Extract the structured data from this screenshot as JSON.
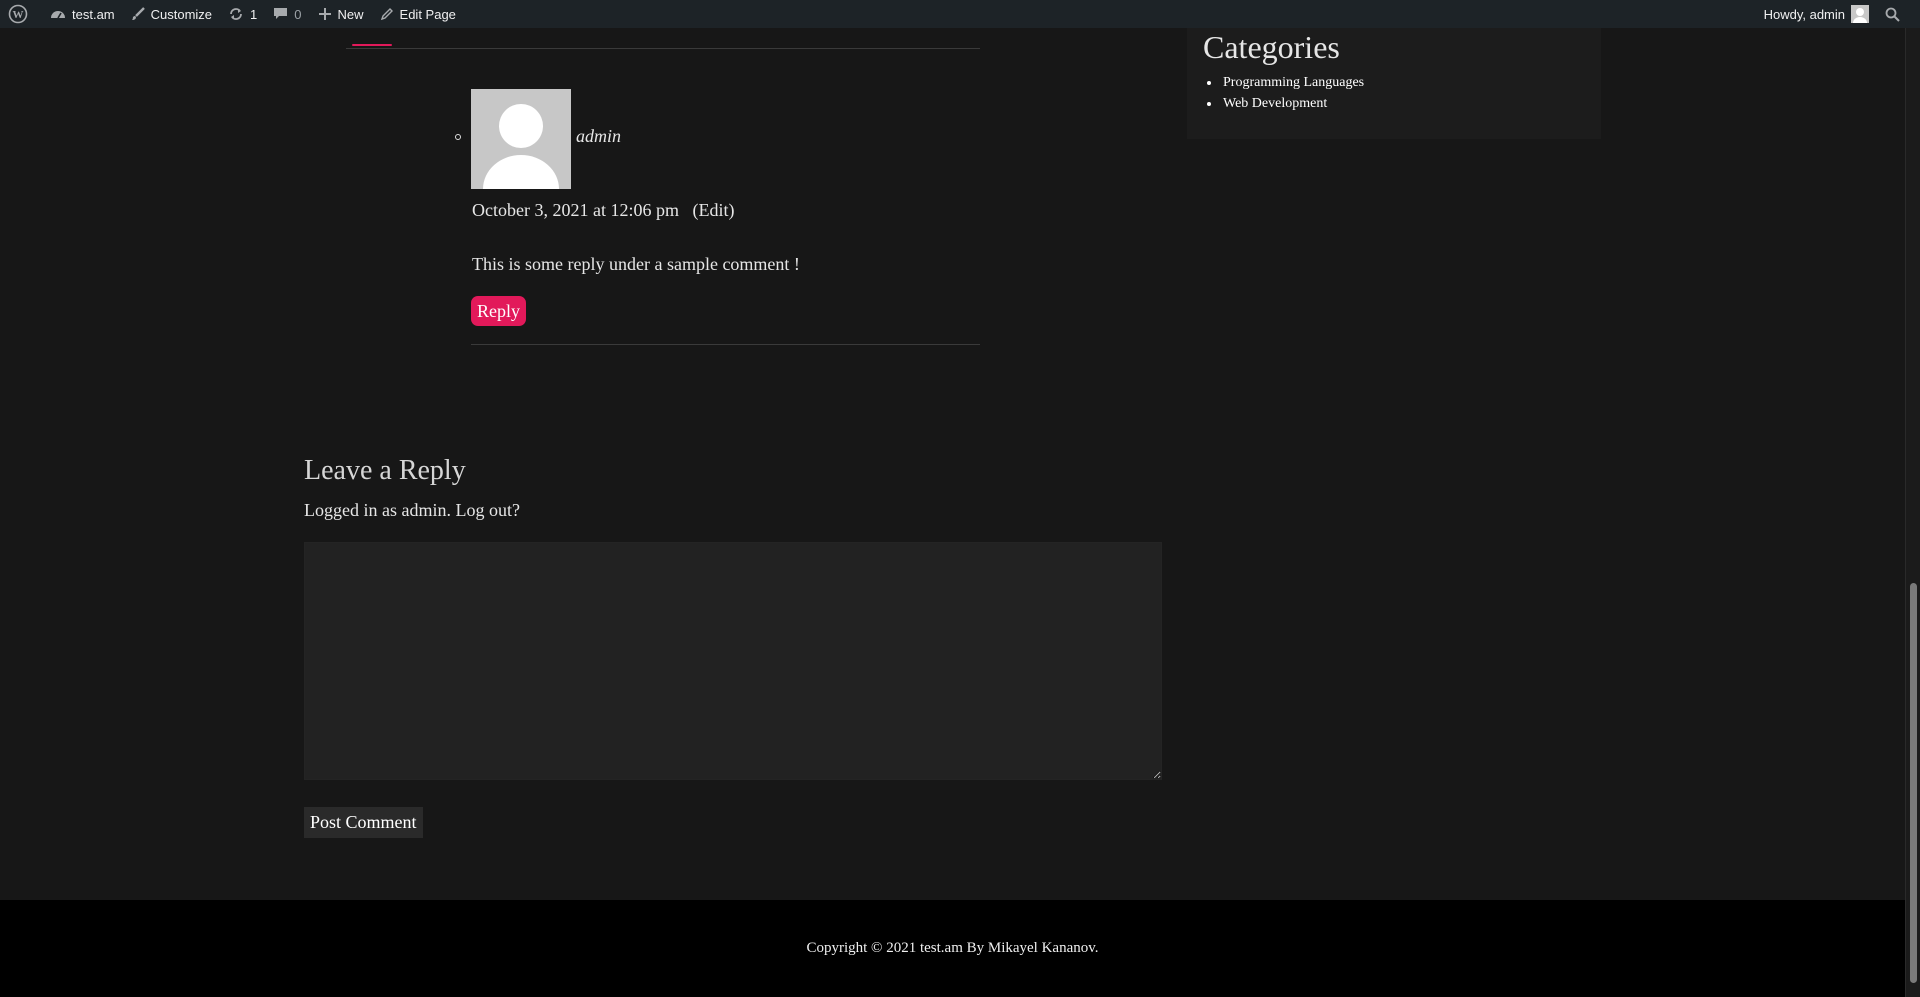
{
  "admin_bar": {
    "site_name": "test.am",
    "customize": "Customize",
    "updates_count": "1",
    "comments_count": "0",
    "new_label": "New",
    "edit_page": "Edit Page",
    "howdy": "Howdy, admin"
  },
  "comment": {
    "author": "admin",
    "date": "October 3, 2021 at 12:06 pm",
    "edit_label": "(Edit)",
    "text": "This is some reply under a sample comment !",
    "reply_label": "Reply"
  },
  "leave_reply": {
    "heading": "Leave a Reply",
    "logged_in_prefix": "Logged in as admin.",
    "logout_label": "Log out?",
    "post_button": "Post Comment"
  },
  "sidebar": {
    "title": "Categories",
    "items": [
      {
        "label": "Programming Languages"
      },
      {
        "label": "Web Development"
      }
    ]
  },
  "footer": {
    "copyright": "Copyright © 2021 test.am By Mikayel Kananov."
  },
  "colors": {
    "accent": "#e2195a",
    "admin_bar_bg": "#1d2327",
    "page_bg": "#171717",
    "footer_bg": "#000000"
  }
}
